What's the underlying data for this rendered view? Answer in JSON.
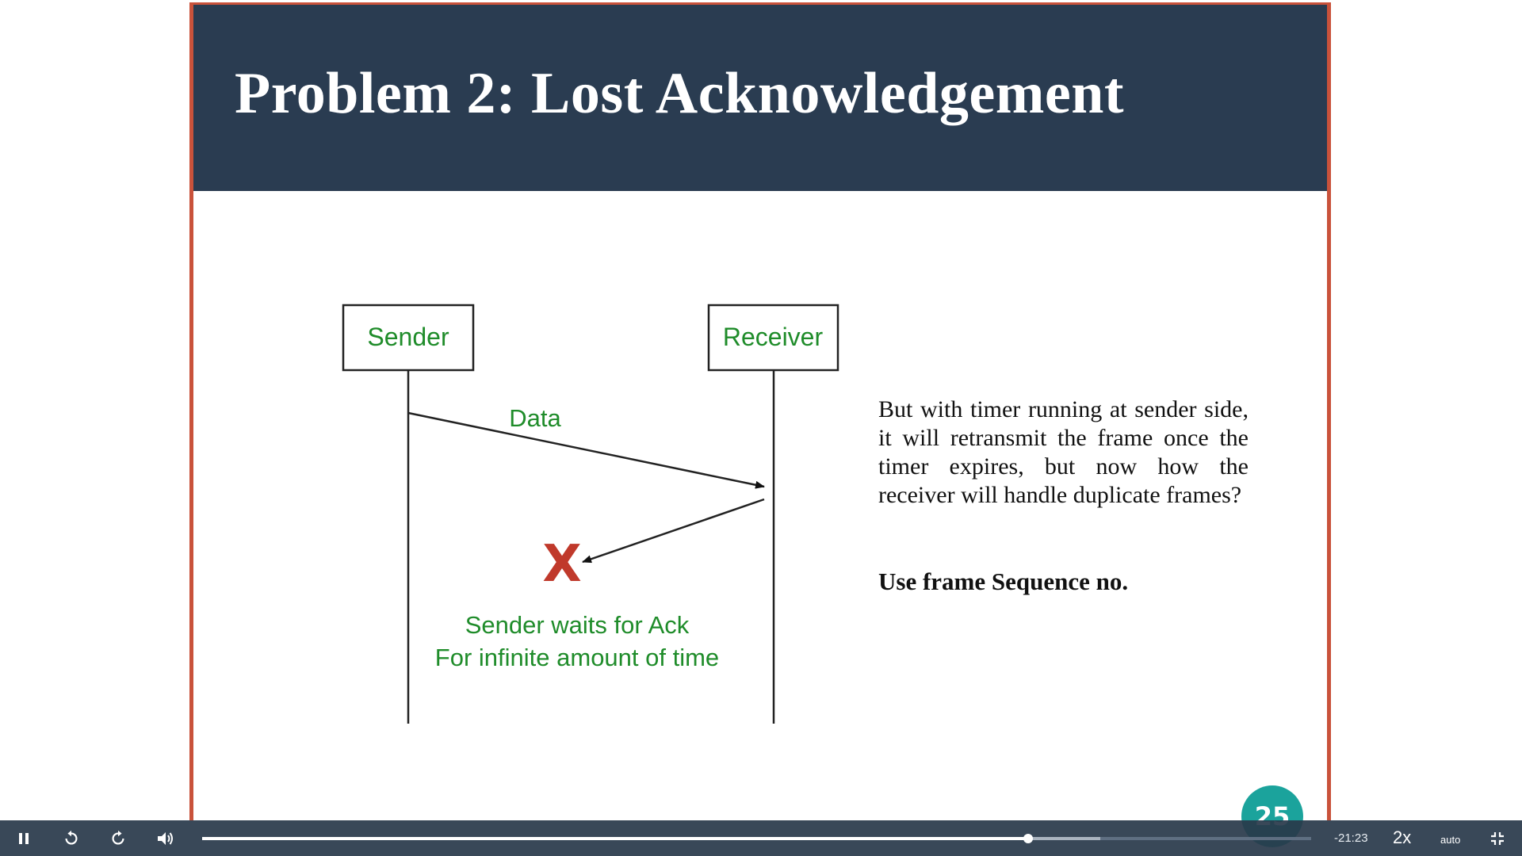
{
  "slide": {
    "title": "Problem 2: Lost Acknowledgement",
    "page_number": "25",
    "diagram": {
      "sender_label": "Sender",
      "receiver_label": "Receiver",
      "data_label": "Data",
      "lost_marker": "X",
      "caption_line1": "Sender waits for Ack",
      "caption_line2": "For infinite amount of time"
    },
    "explanation": "But with timer running at sender side, it will retransmit the frame once the timer expires, but now how the receiver will handle duplicate frames?",
    "emphasis": "Use frame Sequence no."
  },
  "player": {
    "time_remaining": "-21:23",
    "speed": "2x",
    "quality": "auto",
    "progress_fraction": 0.745,
    "buffered_fraction": 0.81,
    "icons": {
      "play_pause": "pause-icon",
      "rewind": "rewind-icon",
      "forward": "forward-icon",
      "volume": "volume-icon",
      "fullscreen": "exit-fullscreen-icon"
    }
  },
  "colors": {
    "header_bg": "#2a3c51",
    "slide_border": "#c9523b",
    "diagram_text": "#1f8c2a",
    "lost_marker": "#c0392b",
    "page_badge": "#1ba39c"
  }
}
